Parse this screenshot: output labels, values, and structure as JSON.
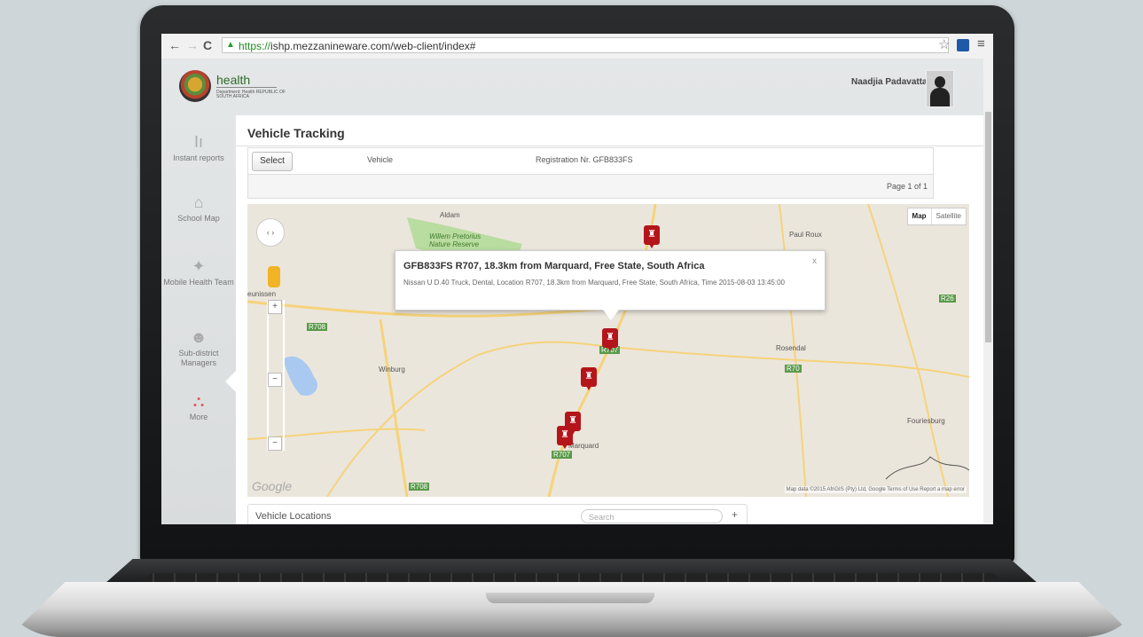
{
  "browser": {
    "back": "←",
    "forward": "→",
    "reload": "C",
    "url_protocol": "https://",
    "url_rest": "ishp.mezzanineware.com/web-client/index#",
    "star": "☆",
    "menu": "≡"
  },
  "header": {
    "brand": "health",
    "brand_sub": "Department: Health REPUBLIC OF SOUTH AFRICA",
    "username": "Naadjia Padavattan"
  },
  "sidebar": {
    "items": [
      {
        "label": "Instant reports",
        "icon": "bar-chart-icon",
        "glyph": "Iı"
      },
      {
        "label": "School Map",
        "icon": "home-icon",
        "glyph": "⌂"
      },
      {
        "label": "Mobile Health Team",
        "icon": "team-icon",
        "glyph": "✦"
      },
      {
        "label": "Sub-district Managers",
        "icon": "person-icon",
        "glyph": "☻"
      },
      {
        "label": "More",
        "icon": "hierarchy-icon",
        "glyph": "⛬"
      }
    ]
  },
  "page": {
    "title": "Vehicle Tracking",
    "select_label": "Select",
    "col_vehicle": "Vehicle",
    "registration": "Registration Nr. GFB833FS",
    "pager": "Page 1 of 1"
  },
  "map": {
    "type_map": "Map",
    "type_satellite": "Satellite",
    "labels": {
      "aldam": "Aldam",
      "reserve": "Willem Pretorius Nature Reserve",
      "paul_roux": "Paul Roux",
      "winburg": "Winburg",
      "rosendal": "Rosendal",
      "fouriesburg": "Fouriesburg",
      "marquard": "Marquard",
      "theunissen": "eunissen",
      "r708": "R708",
      "r707": "R707",
      "r70": "R70",
      "r708b": "R708",
      "r26": "R26",
      "r707b": "R707"
    },
    "popup_title": "GFB833FS R707, 18.3km from Marquard, Free State, South Africa",
    "popup_body": "Nissan U D.40 Truck, Dental, Location R707, 18.3km from Marquard, Free State, South Africa, Time 2015-08-03 13:45:00",
    "popup_close": "x",
    "google": "Google",
    "attribution": "Map data ©2015 AfriGIS (Pty) Ltd, Google   Terms of Use   Report a map error",
    "zoom_in": "+",
    "zoom_out": "−",
    "pan": "‹ ›",
    "marker_glyph": "♜"
  },
  "vehicle_locations": {
    "title": "Vehicle Locations",
    "search_placeholder": "Search",
    "add": "+"
  }
}
